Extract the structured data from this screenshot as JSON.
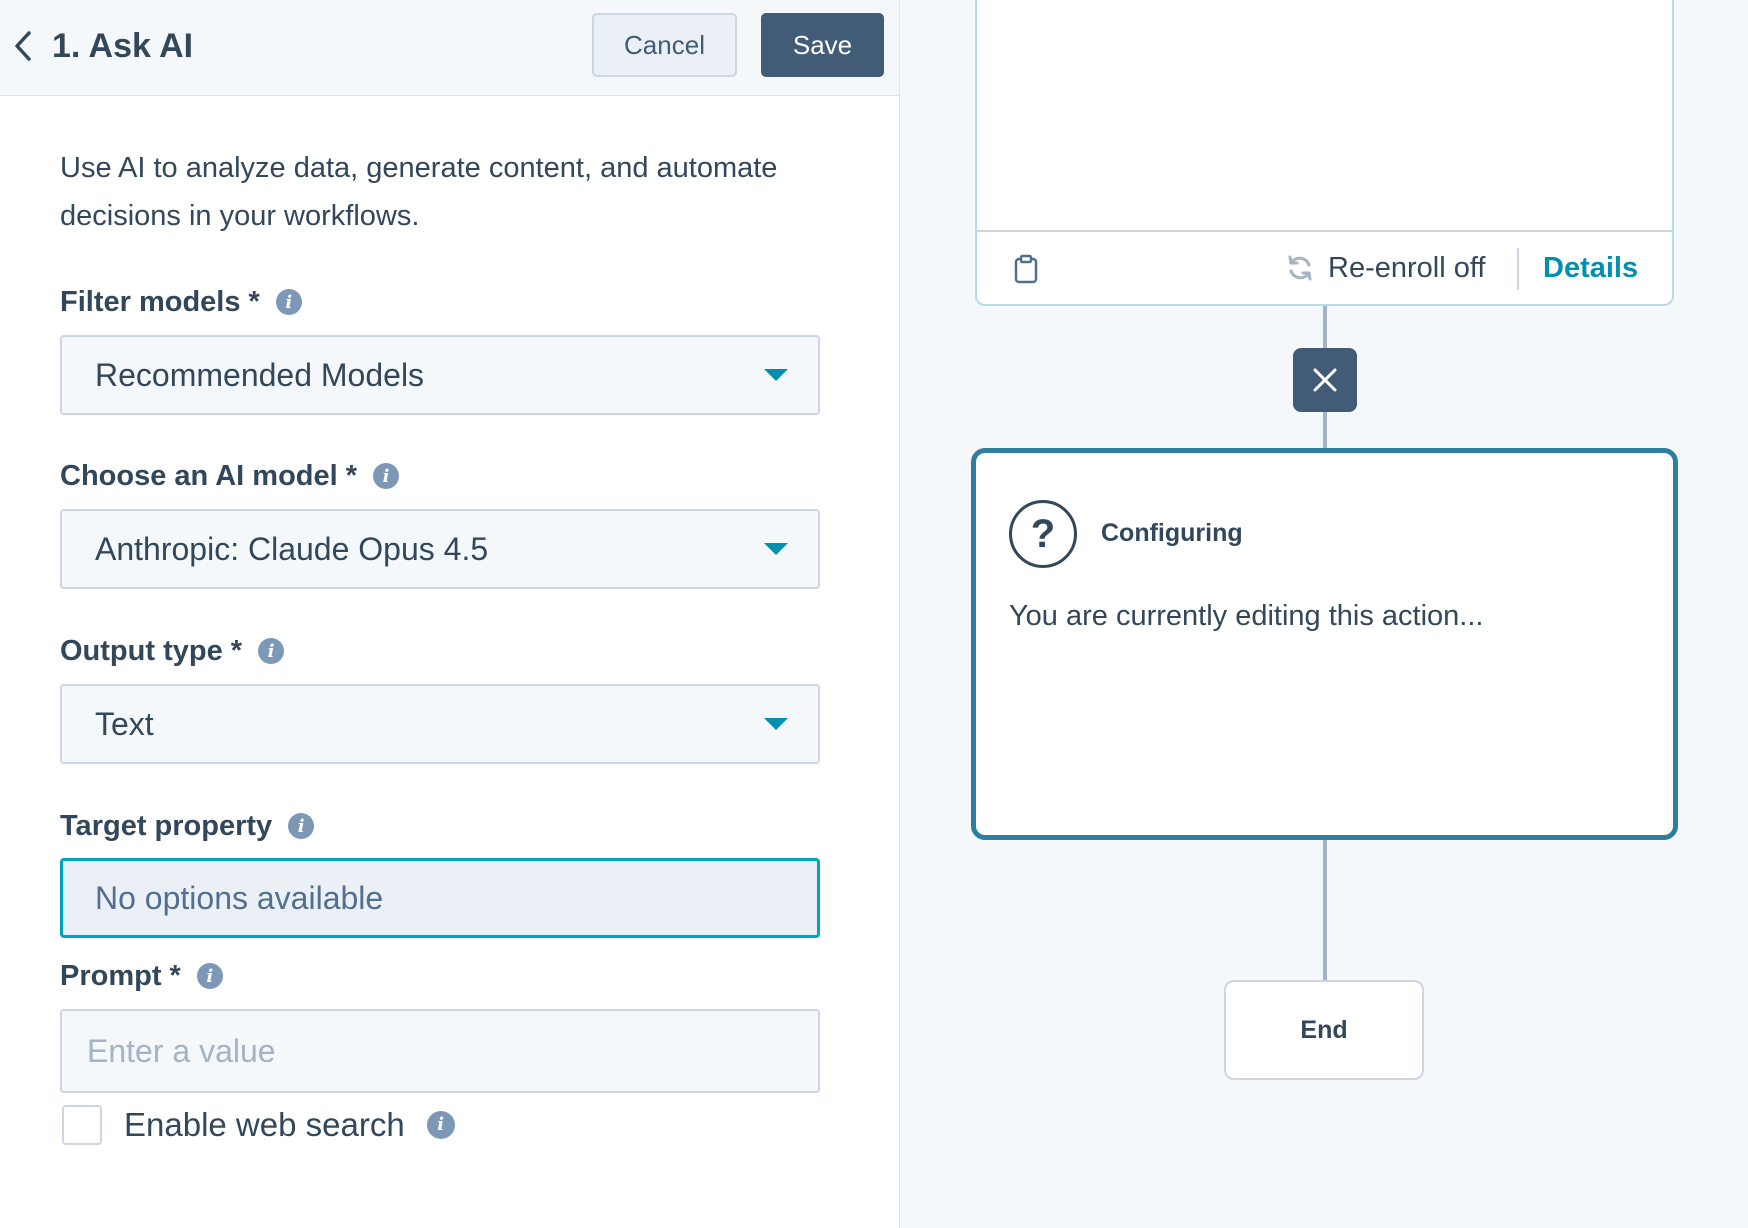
{
  "header": {
    "title": "1. Ask AI",
    "cancel_label": "Cancel",
    "save_label": "Save"
  },
  "panel": {
    "description": "Use AI to analyze data, generate content, and automate decisions in your workflows.",
    "filter_models": {
      "label": "Filter models *",
      "value": "Recommended Models"
    },
    "ai_model": {
      "label": "Choose an AI model *",
      "value": "Anthropic: Claude Opus 4.5"
    },
    "output_type": {
      "label": "Output type *",
      "value": "Text"
    },
    "target_property": {
      "label": "Target property",
      "value": "No options available"
    },
    "prompt": {
      "label": "Prompt *",
      "placeholder": "Enter a value",
      "value": ""
    },
    "web_search": {
      "label": "Enable web search",
      "checked": false
    }
  },
  "canvas": {
    "reenroll_label": "Re-enroll off",
    "details_label": "Details",
    "config_card": {
      "title": "Configuring",
      "text": "You are currently editing this action..."
    },
    "end_label": "End"
  },
  "colors": {
    "accent": "#0091ae",
    "primary_button": "#425b76",
    "focus_border": "#00a4bd",
    "card_border": "#2e7ea0"
  }
}
